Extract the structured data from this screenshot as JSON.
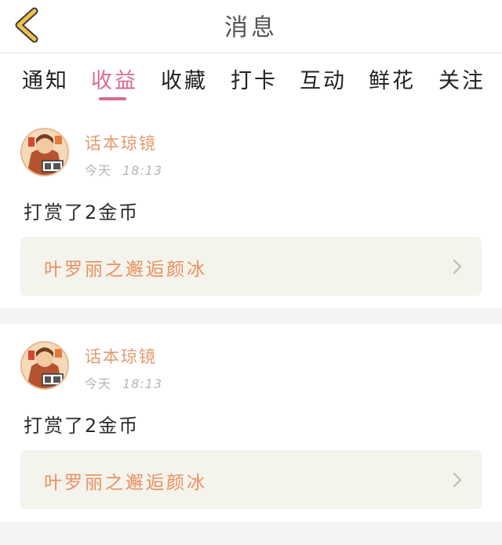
{
  "header": {
    "title": "消息"
  },
  "tabs": [
    {
      "label": "通知",
      "active": false
    },
    {
      "label": "收益",
      "active": true
    },
    {
      "label": "收藏",
      "active": false
    },
    {
      "label": "打卡",
      "active": false
    },
    {
      "label": "互动",
      "active": false
    },
    {
      "label": "鲜花",
      "active": false
    },
    {
      "label": "关注",
      "active": false
    }
  ],
  "colors": {
    "accent": "#d96a93",
    "user_name": "#e29a6e",
    "book_title": "#e89060",
    "back_arrow": "#f0c14b"
  },
  "messages": [
    {
      "user_name": "话本琼镜",
      "day": "今天",
      "time": "18:13",
      "text": "打赏了2金币",
      "book_title": "叶罗丽之邂逅颜冰"
    },
    {
      "user_name": "话本琼镜",
      "day": "今天",
      "time": "18:13",
      "text": "打赏了2金币",
      "book_title": "叶罗丽之邂逅颜冰"
    }
  ]
}
